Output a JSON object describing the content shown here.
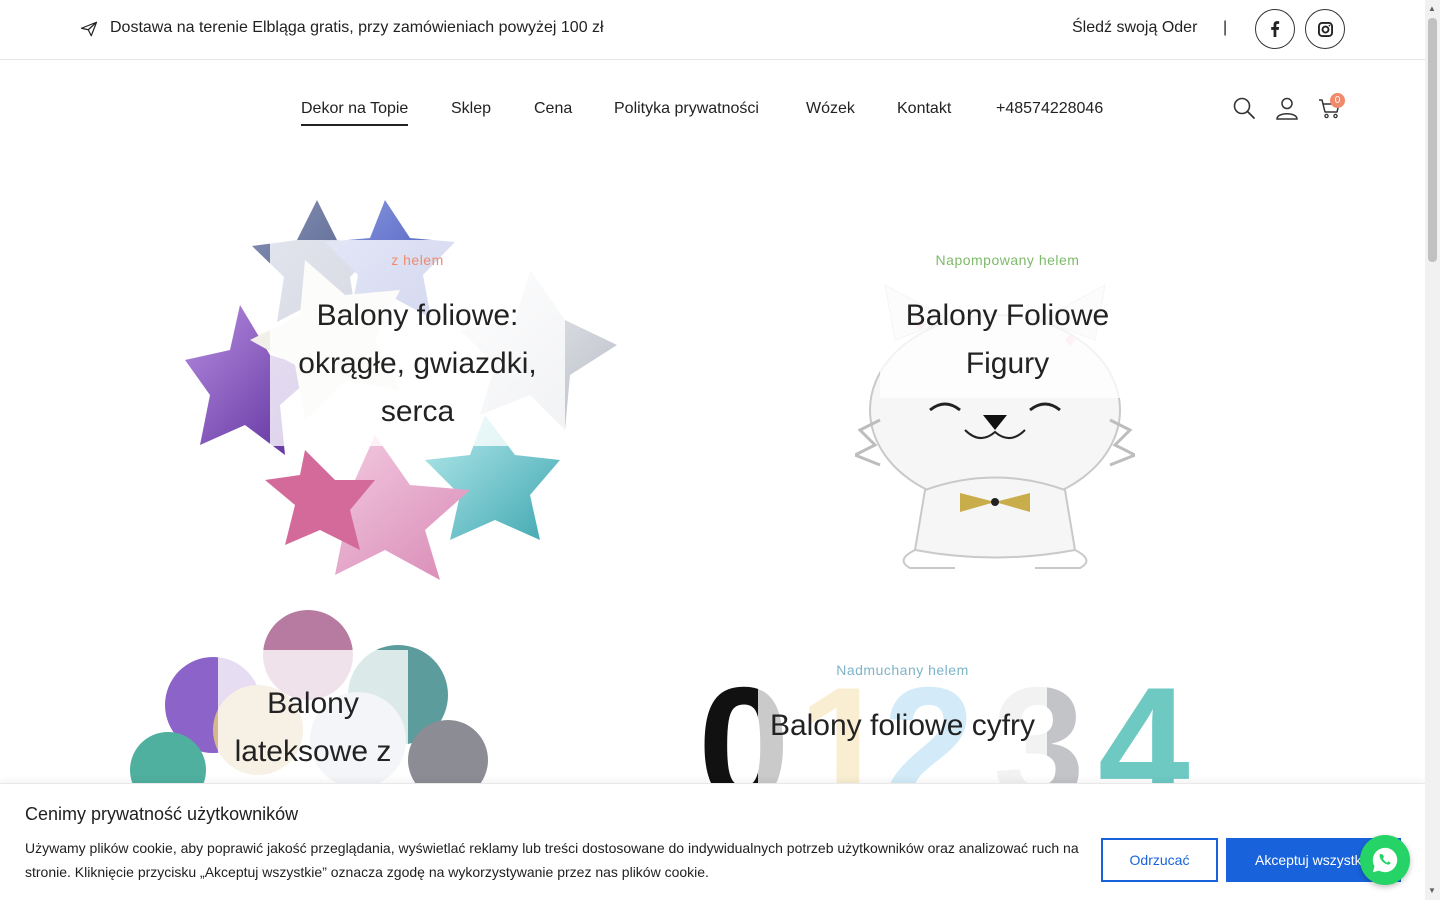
{
  "topbar": {
    "promo_text": "Dostawa na terenie Elbląga gratis, przy zamówieniach powyżej 100 zł",
    "track_link": "Śledź swoją Oder",
    "separator": "|"
  },
  "nav": {
    "items": [
      {
        "label": "Dekor na Topie",
        "active": true
      },
      {
        "label": "Sklep"
      },
      {
        "label": "Cena"
      },
      {
        "label": "Polityka prywatności"
      },
      {
        "label": "Wózek"
      },
      {
        "label": "Kontakt"
      },
      {
        "label": "+48574228046"
      }
    ],
    "cart_count": "0"
  },
  "cards": [
    {
      "subtitle": "z helem",
      "subtitle_color": "#f08a6c",
      "title": "Balony foliowe: okrągłe, gwiazdki, serca"
    },
    {
      "subtitle": "Napompowany helem",
      "subtitle_color": "#7dba6a",
      "title": "Balony Foliowe Figury"
    },
    {
      "subtitle": "",
      "title": "Balony lateksowe z"
    },
    {
      "subtitle": "Nadmuchany helem",
      "subtitle_color": "#7fb3c9",
      "title": "Balony foliowe cyfry"
    }
  ],
  "digits": [
    "0",
    "1",
    "2",
    "3",
    "4"
  ],
  "cookie": {
    "title": "Cenimy prywatność użytkowników",
    "text": "Używamy plików cookie, aby poprawić jakość przeglądania, wyświetlać reklamy lub treści dostosowane do indywidualnych potrzeb użytkowników oraz analizować ruch na stronie. Kliknięcie przycisku „Akceptuj wszystkie” oznacza zgodę na wykorzystywanie przez nas plików cookie.",
    "reject": "Odrzucać",
    "accept": "Akceptuj wszystkie"
  },
  "colors": {
    "accent_blue": "#1863dc",
    "badge": "#f08a6c",
    "whatsapp": "#25d366"
  }
}
